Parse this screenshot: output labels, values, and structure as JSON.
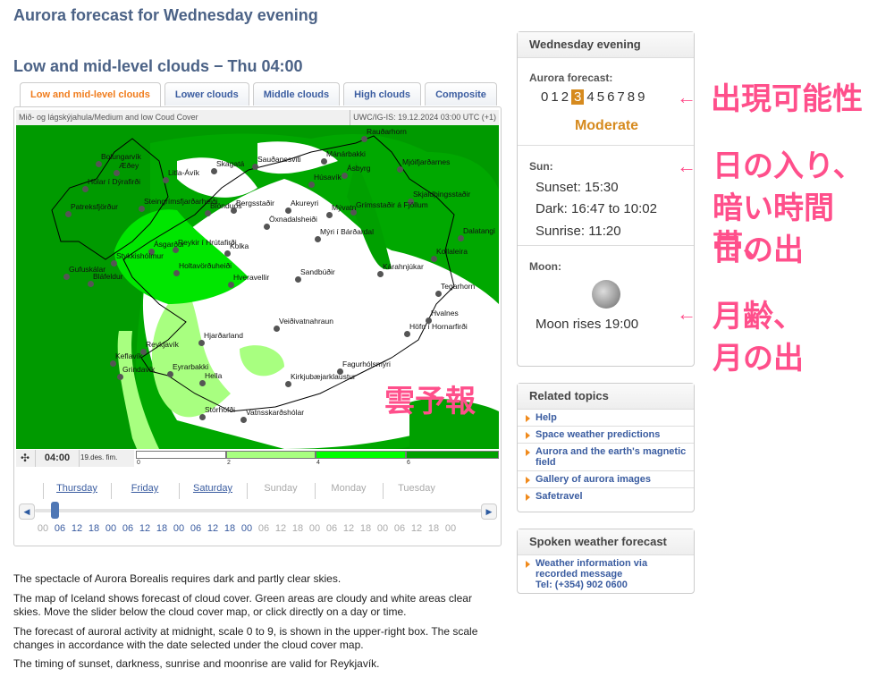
{
  "page_title": "Aurora forecast for Wednesday evening",
  "section_title": "Low and mid-level clouds − Thu 04:00",
  "tabs": [
    {
      "label": "Low and mid-level clouds",
      "active": true
    },
    {
      "label": "Lower clouds"
    },
    {
      "label": "Middle clouds"
    },
    {
      "label": "High clouds"
    },
    {
      "label": "Composite"
    }
  ],
  "map": {
    "caption": "Mið- og lágskýjahula/Medium and low Coud Cover",
    "source": "UWC/IG-IS: 19.12.2024 03:00 UTC (+1)",
    "colors": {
      "sea_cloud": "#009a00",
      "cloud_mid": "#00ff00",
      "cloud_light": "#a8ff80",
      "clear": "#ffffff"
    },
    "places": [
      "Rauðarhorn",
      "Bolungarvík",
      "Æðey",
      "Hólar í Dýrafirði",
      "Litla-Ávík",
      "Skagatá",
      "Sauðanesviti",
      "Mánárbakki",
      "Ásbyrg",
      "Mjóifjarðarnes",
      "Húsavík",
      "Steingrímsfjarðarheiði",
      "Blönduós",
      "Bergsstaðir",
      "Skjaldþingsstaðir",
      "Grímsstaðir á Fjöllum",
      "Akureyri",
      "Mývatn",
      "Patreksfjörður",
      "Öxnadalsheiði",
      "Mýri í Bárðardal",
      "Dalatangi",
      "Ásgarður",
      "Reykir í Hrútafirði",
      "Kolka",
      "Kollaleira",
      "Stykkishólmur",
      "Holtavörðuheiði",
      "Kárahnjúkar",
      "Sandbúðir",
      "Gufuskálar",
      "Bláfeldur",
      "Hveravellir",
      "Tegarhorn",
      "Veiðivatnahraun",
      "Hvalnes",
      "Höfn í Hornarfirði",
      "Hjarðarland",
      "Reykjavík",
      "Keflavík",
      "Grindavík",
      "Eyrarbakki",
      "Hella",
      "Fagurhólsmýri",
      "Kirkjubæjarklaustur",
      "Stórhöfði",
      "Vatnsskarðshólar"
    ]
  },
  "controls": {
    "time": "04:00",
    "date": "19.des. fim.",
    "scale_ticks": [
      "0",
      "2",
      "4",
      "6"
    ],
    "scale_colors": [
      "#ffffff",
      "#a8ff80",
      "#00ff00",
      "#00a000"
    ]
  },
  "timeline": {
    "days": [
      {
        "label": "Thursday",
        "link": true
      },
      {
        "label": "Friday",
        "link": true
      },
      {
        "label": "Saturday",
        "link": true
      },
      {
        "label": "Sunday",
        "link": false
      },
      {
        "label": "Monday",
        "link": false
      },
      {
        "label": "Tuesday",
        "link": false
      }
    ],
    "hours": [
      "00",
      "06",
      "12",
      "18",
      "00",
      "06",
      "12",
      "18",
      "00",
      "06",
      "12",
      "18",
      "00",
      "06",
      "12",
      "18",
      "00",
      "06",
      "12",
      "18",
      "00",
      "06",
      "12",
      "18",
      "00"
    ],
    "slider_position_hours": 4
  },
  "sidebar": {
    "heading": "Wednesday evening",
    "aurora_label": "Aurora forecast:",
    "scale": [
      "0",
      "1",
      "2",
      "3",
      "4",
      "5",
      "6",
      "7",
      "8",
      "9"
    ],
    "aurora_value": 3,
    "aurora_text": "Moderate",
    "accent": "#d68a1e",
    "sun_label": "Sun:",
    "sunset": "Sunset: 15:30",
    "dark": "Dark: 16:47 to 10:02",
    "sunrise": "Sunrise: 11:20",
    "moon_label": "Moon:",
    "moon_rise": "Moon rises 19:00",
    "related_heading": "Related topics",
    "related": [
      "Help",
      "Space weather predictions",
      "Aurora and the earth's magnetic field",
      "Gallery of aurora images",
      "Safetravel"
    ],
    "spoken_heading": "Spoken weather forecast",
    "spoken_link": "Weather information via recorded message",
    "spoken_tel": "Tel: (+354) 902 0600"
  },
  "paragraphs": [
    "The spectacle of Aurora Borealis requires dark and partly clear skies.",
    "The map of Iceland shows forecast of cloud cover. Green areas are cloudy and white areas clear skies. Move the slider below the cloud cover map, or click directly on a day or time.",
    "The forecast of auroral activity at midnight, scale 0 to 9, is shown in the upper-right box. The scale changes in accordance with the date selected under the cloud cover map.",
    "The timing of sunset, darkness, sunrise and moonrise are valid for Reykjavík."
  ],
  "annotations": {
    "aurora": "出現可能性",
    "sun_1": "日の入り、",
    "sun_2": "暗い時間帯、",
    "sun_3": "日の出",
    "moon_1": "月齢、",
    "moon_2": "月の出",
    "clouds": "雲予報",
    "color": "#ff4f8b"
  }
}
